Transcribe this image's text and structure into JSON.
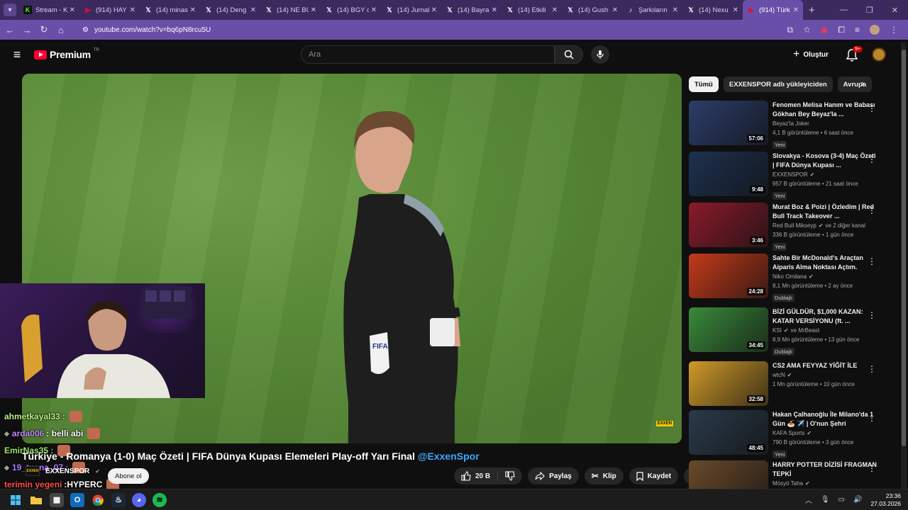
{
  "browser": {
    "tabs": [
      {
        "title": "Stream - K",
        "icon": "kick-icon",
        "color": "#53fc18"
      },
      {
        "title": "(914) HAY",
        "icon": "youtube-icon",
        "color": "#ff0033"
      },
      {
        "title": "(14) minas",
        "icon": "x-icon",
        "color": "#ffffff"
      },
      {
        "title": "(14) Deng",
        "icon": "x-icon",
        "color": "#ffffff"
      },
      {
        "title": "(14) NE BU",
        "icon": "x-icon",
        "color": "#ffffff"
      },
      {
        "title": "(14) BGY d",
        "icon": "x-icon",
        "color": "#ffffff"
      },
      {
        "title": "(14) Jurnal",
        "icon": "x-icon",
        "color": "#ffffff"
      },
      {
        "title": "(14) Bayra",
        "icon": "x-icon",
        "color": "#ffffff"
      },
      {
        "title": "(14) Etkili",
        "icon": "x-icon",
        "color": "#ffffff"
      },
      {
        "title": "(14) Gush",
        "icon": "x-icon",
        "color": "#ffffff"
      },
      {
        "title": "Şarkıların",
        "icon": "tiktok-icon",
        "color": "#ffffff"
      },
      {
        "title": "(14) Nexu",
        "icon": "x-icon",
        "color": "#ffffff"
      },
      {
        "title": "(914) Türk",
        "icon": "youtube-icon",
        "color": "#ff0033",
        "active": true
      }
    ],
    "url": "youtube.com/watch?v=bq6pN8rcu5U"
  },
  "header": {
    "logo_text": "Premium",
    "logo_sup": "TR",
    "search_placeholder": "Ara",
    "create_label": "Oluştur",
    "notif_count": "9+"
  },
  "video": {
    "title": "Türkiye - Romanya (1-0) Maç Özeti | FIFA Dünya Kupası Elemeleri Play-off Yarı Final",
    "hashtag": "@ExxenSpor",
    "channel": "EXXENSPOR",
    "channel_logo": "EXXEN",
    "subscribe_label": "Abone ol",
    "likes": "20 B",
    "share_label": "Paylaş",
    "clip_label": "Klip",
    "save_label": "Kaydet",
    "watermark": "EXXEN"
  },
  "chat": [
    {
      "user": "ahmetkayal33 :",
      "msg": "",
      "color": "#b9f08a",
      "badge": false
    },
    {
      "user": "arda006",
      "msg": ": belli abi",
      "color": "#c58cff",
      "badge": true
    },
    {
      "user": "EmirNas35 :",
      "msg": "",
      "color": "#9ce86a",
      "badge": false
    },
    {
      "user": "19_tuana_07 :",
      "msg": "",
      "color": "#b07bff",
      "badge": true
    },
    {
      "user": "terimin yegeni",
      "msg": ":HYPERC",
      "color": "#ff4d4d",
      "badge": false
    }
  ],
  "chips": [
    "Tümü",
    "EXXENSPOR adlı yükleyiciden",
    "Avrupa"
  ],
  "recommendations": [
    {
      "title": "Fenomen Melisa Hanım ve Babası Gökhan Bey Beyaz'la ...",
      "channel": "Beyaz'la Joker",
      "verified": false,
      "views": "4,1 B görüntüleme",
      "age": "6 saat önce",
      "badge": "Yeni",
      "duration": "57:06",
      "thumb": "#2b3d6a"
    },
    {
      "title": "Slovakya - Kosova (3-4) Maç Özeti | FIFA Dünya Kupası ...",
      "channel": "EXXENSPOR",
      "verified": true,
      "views": "957 B görüntüleme",
      "age": "21 saat önce",
      "badge": "Yeni",
      "duration": "9:48",
      "thumb": "#1d3150"
    },
    {
      "title": "Murat Boz & Poizi | Özledim | Red Bull Track Takeover ...",
      "channel": "Red Bull Mikseyp",
      "verified": true,
      "extra": "ve 2 diğer kanal",
      "views": "336 B görüntüleme",
      "age": "1 gün önce",
      "badge": "Yeni",
      "duration": "3:46",
      "thumb": "#8a1a2a"
    },
    {
      "title": "Sahte Bir McDonald's Araçtan Aiparis Alma Noktası Açtım.",
      "channel": "Niko Omilana",
      "verified": true,
      "views": "8,1 Mn görüntüleme",
      "age": "2 ay önce",
      "badge": "Dublajlı",
      "duration": "24:28",
      "thumb": "#c43a1a"
    },
    {
      "title": "BİZİ GÜLDÜR, $1,000 KAZAN: KATAR VERSİYONU (ft. ...",
      "channel": "KSI",
      "verified": true,
      "extra": "ve MrBeast",
      "views": "8,9 Mn görüntüleme",
      "age": "13 gün önce",
      "badge": "Dublajlı",
      "duration": "34:45",
      "thumb": "#3a8a3a"
    },
    {
      "title": "CS2 AMA FEYYAZ YİĞİT İLE",
      "channel": "wtcN",
      "verified": true,
      "views": "1 Mn görüntüleme",
      "age": "10 gün önce",
      "badge": "",
      "duration": "32:58",
      "thumb": "#d09a2a"
    },
    {
      "title": "Hakan Çalhanoğlu İle Milano'da 1 Gün 🍝 ✈️ | O'nun Şehri",
      "channel": "KAFA Sports",
      "verified": true,
      "views": "790 B görüntüleme",
      "age": "3 gün önce",
      "badge": "Yeni",
      "duration": "48:45",
      "thumb": "#2a3a4a"
    },
    {
      "title": "HARRY POTTER DİZİSİ FRAGMAN TEPKİ",
      "channel": "Mösyö Taha",
      "verified": true,
      "views": "",
      "age": "",
      "badge": "",
      "duration": "",
      "thumb": "#6a4a2a"
    }
  ],
  "taskbar": {
    "time": "23:36",
    "date": "27.03.2026"
  }
}
